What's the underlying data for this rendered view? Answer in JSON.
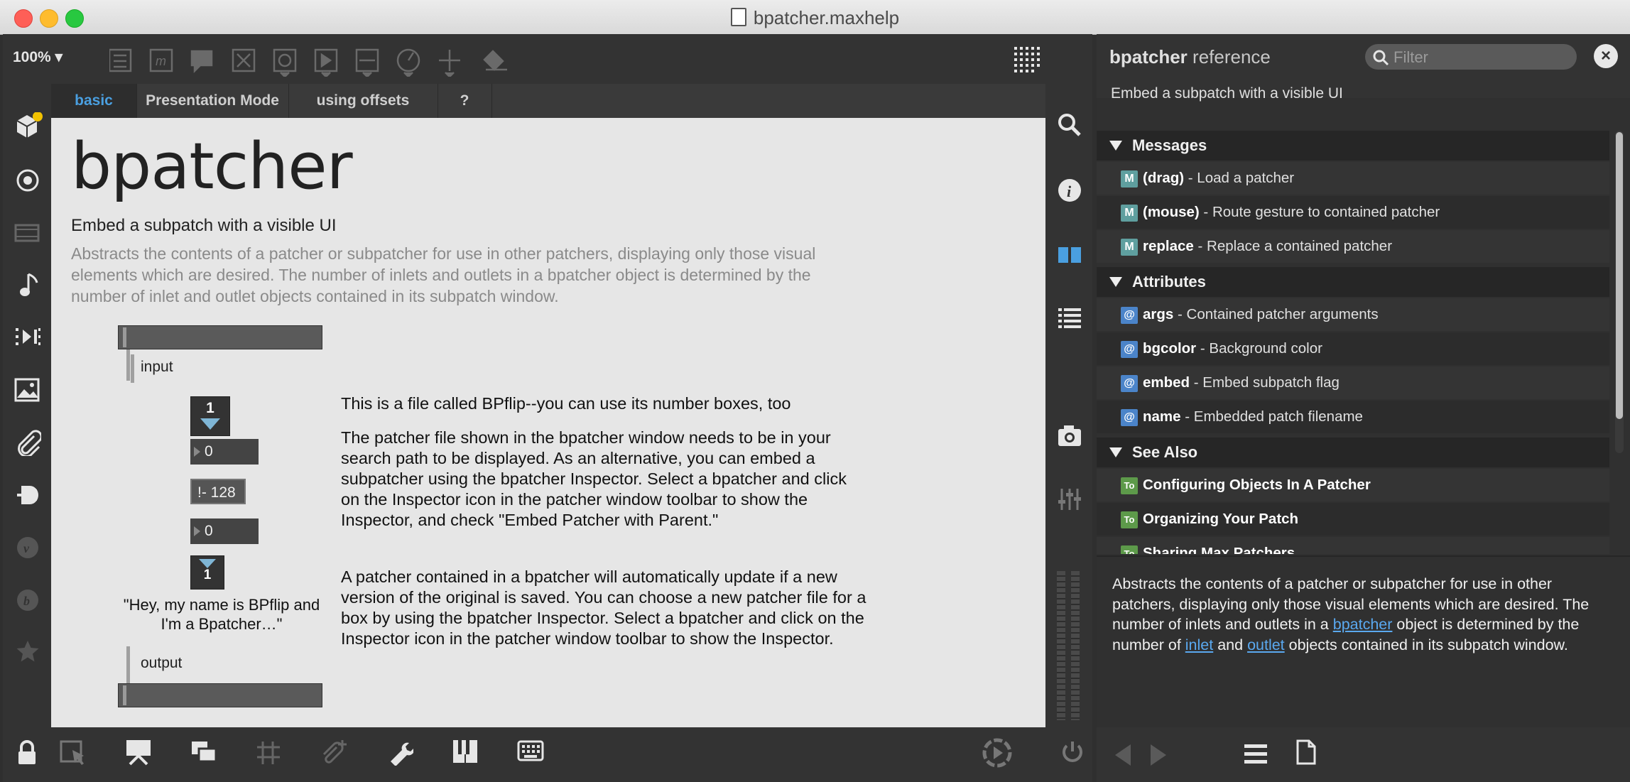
{
  "window": {
    "title": "bpatcher.maxhelp"
  },
  "toolbar": {
    "zoom": "100% ▾",
    "icons": [
      "presentation-icon",
      "message-icon",
      "comment-icon",
      "button-icon",
      "toggle-icon",
      "play-icon",
      "slider-icon",
      "dial-icon",
      "add-icon",
      "paint-bucket-icon",
      "grid-icon"
    ]
  },
  "tabs": [
    {
      "label": "basic",
      "active": true
    },
    {
      "label": "Presentation Mode",
      "active": false
    },
    {
      "label": "using offsets",
      "active": false
    },
    {
      "label": "?",
      "active": false
    }
  ],
  "patch": {
    "title": "bpatcher",
    "subtitle": "Embed a subpatch with a visible UI",
    "description": "Abstracts the contents of a patcher or subpatcher for use in other patchers, displaying only those visual elements which are desired. The number of inlets and outlets in a bpatcher object is determined by the number of inlet and outlet objects contained in its subpatch window.",
    "input_label": "input",
    "output_label": "output",
    "number_top": "1",
    "number_1": "0",
    "inverse_label": "!- 128",
    "number_2": "0",
    "number_bottom": "1",
    "bpflip_quote": "\"Hey, my name is BPflip and I'm a Bpatcher…\"",
    "para1": "This is a file called BPflip--you can use its number boxes, too",
    "para2": "The patcher file shown in the bpatcher window needs to be in your search path to be displayed. As an alternative, you can embed a subpatcher using the bpatcher Inspector. Select a bpatcher and click on the Inspector icon in the patcher window toolbar to show the Inspector, and check \"Embed Patcher with Parent.\"",
    "para3": "A patcher contained in a bpatcher will automatically update if a new version of the original is saved. You can choose a new patcher file for a box by using the bpatcher Inspector. Select a bpatcher and click on the Inspector icon in the patcher window toolbar to show the Inspector."
  },
  "reference": {
    "title_bold": "bpatcher",
    "title_rest": "reference",
    "filter_placeholder": "Filter",
    "summary": "Embed a subpatch with a visible UI",
    "messages_header": "Messages",
    "messages": [
      {
        "name": "(drag)",
        "desc": " - Load a patcher"
      },
      {
        "name": "(mouse)",
        "desc": " - Route gesture to contained patcher"
      },
      {
        "name": "replace",
        "desc": " - Replace a contained patcher"
      }
    ],
    "attributes_header": "Attributes",
    "attributes": [
      {
        "name": "args",
        "desc": " - Contained patcher arguments"
      },
      {
        "name": "bgcolor",
        "desc": " - Background color"
      },
      {
        "name": "embed",
        "desc": " - Embed subpatch flag"
      },
      {
        "name": "name",
        "desc": " - Embedded patch filename"
      }
    ],
    "see_also_header": "See Also",
    "see_also": [
      {
        "name": "Configuring Objects In A Patcher"
      },
      {
        "name": "Organizing Your Patch"
      },
      {
        "name": "Sharing Max Patchers"
      }
    ],
    "body_1": "Abstracts the contents of a patcher or subpatcher for use in other patchers, displaying only those visual elements which are desired. The number of inlets and outlets in a ",
    "link_bpatcher": "bpatcher",
    "body_2": " object is determined by the number of ",
    "link_inlet": "inlet",
    "body_3": " and ",
    "link_outlet": "outlet",
    "body_4": " objects contained in its subpatch window."
  }
}
